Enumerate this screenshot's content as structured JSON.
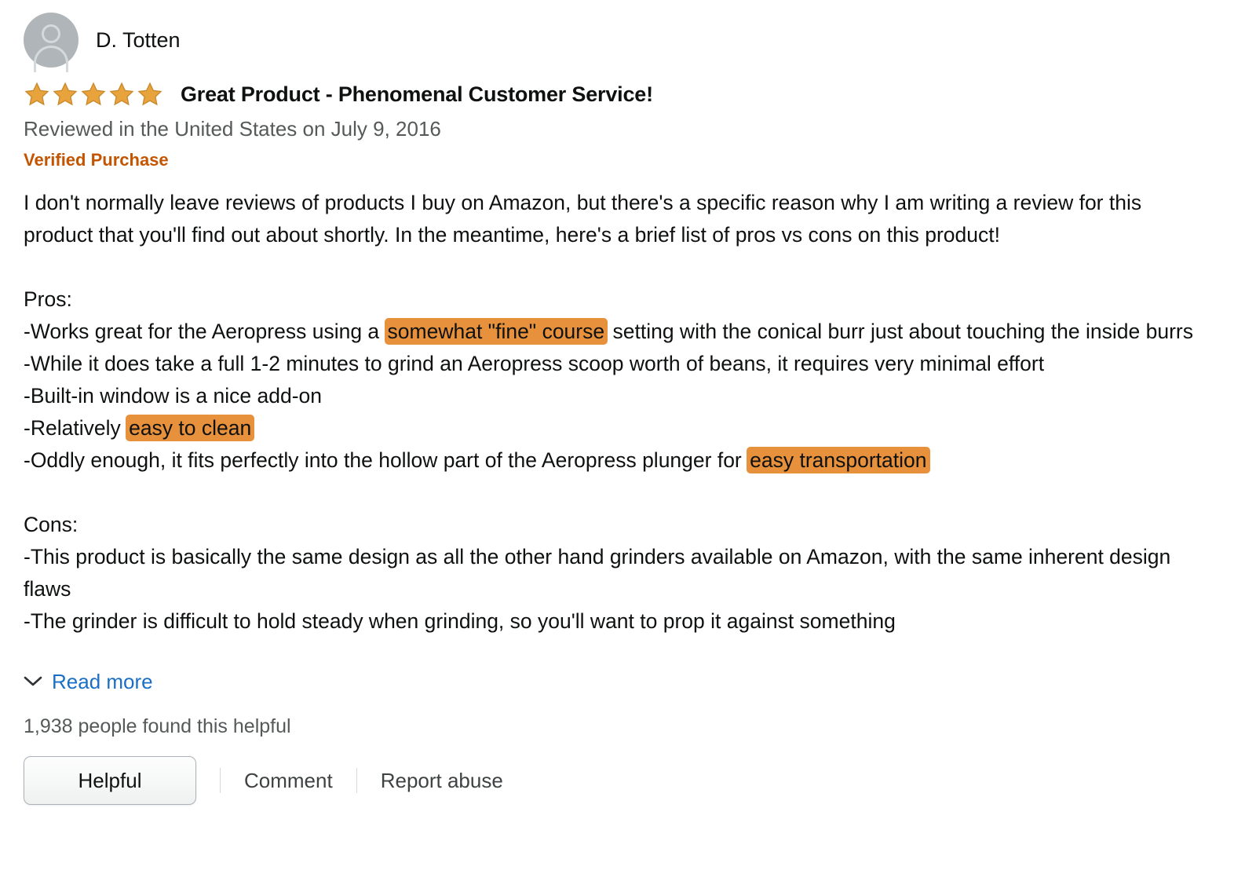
{
  "review": {
    "reviewer": {
      "name": "D. Totten",
      "avatar_icon": "user-avatar-icon"
    },
    "rating": {
      "value": 5,
      "max": 5,
      "star_icon": "star-filled-icon",
      "star_color": "#E8A33D"
    },
    "title": "Great Product - Phenomenal Customer Service!",
    "date_line": "Reviewed in the United States on July 9, 2016",
    "verified_purchase_label": "Verified Purchase",
    "verified_purchase_color": "#C45500",
    "highlight_color": "#E8913C",
    "body": {
      "para1": "I don't normally leave reviews of products I buy on Amazon, but there's a specific reason why I am writing a review for this product that you'll find out about shortly. In the meantime, here's a brief list of pros vs cons on this product!",
      "pros_heading": "Pros:",
      "pro1_before": "-Works great for the Aeropress using a ",
      "pro1_highlight": "somewhat \"fine\" course",
      "pro1_after": " setting with the conical burr just about touching the inside burrs",
      "pro2": "-While it does take a full 1-2 minutes to grind an Aeropress scoop worth of beans, it requires very minimal effort",
      "pro3": "-Built-in window is a nice add-on",
      "pro4_before": "-Relatively ",
      "pro4_highlight": "easy to clean",
      "pro5_before": "-Oddly enough, it fits perfectly into the hollow part of the Aeropress plunger for ",
      "pro5_highlight": "easy transportation",
      "cons_heading": "Cons:",
      "con1": "-This product is basically the same design as all the other hand grinders available on Amazon, with the same inherent design flaws",
      "con2_clipped": "-The grinder is difficult to hold steady when grinding, so you'll want to prop it against something"
    },
    "read_more": {
      "label": "Read more",
      "icon": "chevron-down-icon",
      "color": "#1A6FC4"
    },
    "helpful_count_text": "1,938 people found this helpful",
    "actions": {
      "helpful_label": "Helpful",
      "comment_label": "Comment",
      "report_abuse_label": "Report abuse"
    }
  }
}
